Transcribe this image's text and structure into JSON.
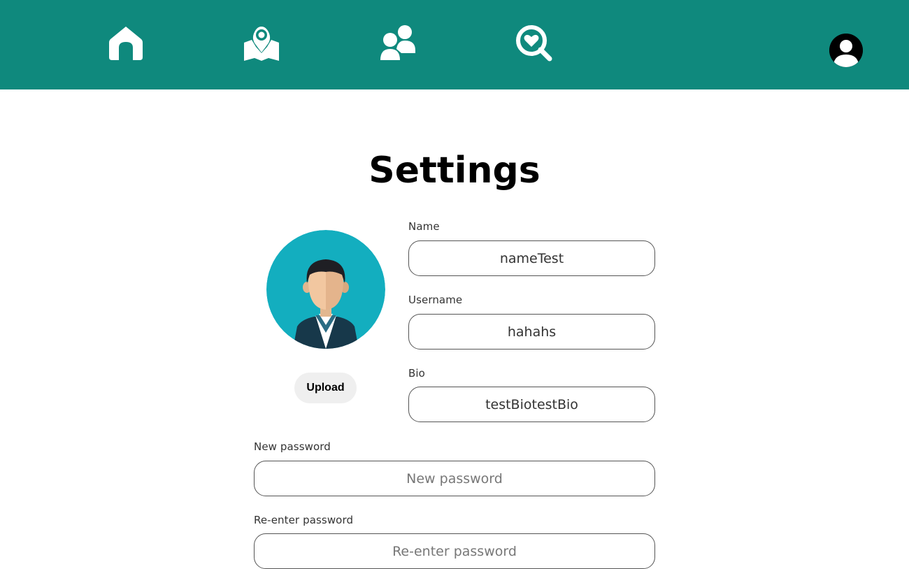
{
  "nav": {
    "items": [
      {
        "icon": "home-icon"
      },
      {
        "icon": "map-pin-icon"
      },
      {
        "icon": "people-icon"
      },
      {
        "icon": "heart-search-icon"
      }
    ],
    "profile_icon": "user-avatar-icon"
  },
  "colors": {
    "navbar": "#0f897d",
    "avatar_bg": "#13aebf"
  },
  "page": {
    "title": "Settings"
  },
  "profile": {
    "avatar_icon": "person-avatar",
    "upload_label": "Upload"
  },
  "form": {
    "name": {
      "label": "Name",
      "value": "nameTest"
    },
    "username": {
      "label": "Username",
      "value": "hahahs"
    },
    "bio": {
      "label": "Bio",
      "value": "testBiotestBio"
    },
    "new_password": {
      "label": "New password",
      "placeholder": "New password"
    },
    "reenter_password": {
      "label": "Re-enter password",
      "placeholder": "Re-enter password"
    }
  }
}
